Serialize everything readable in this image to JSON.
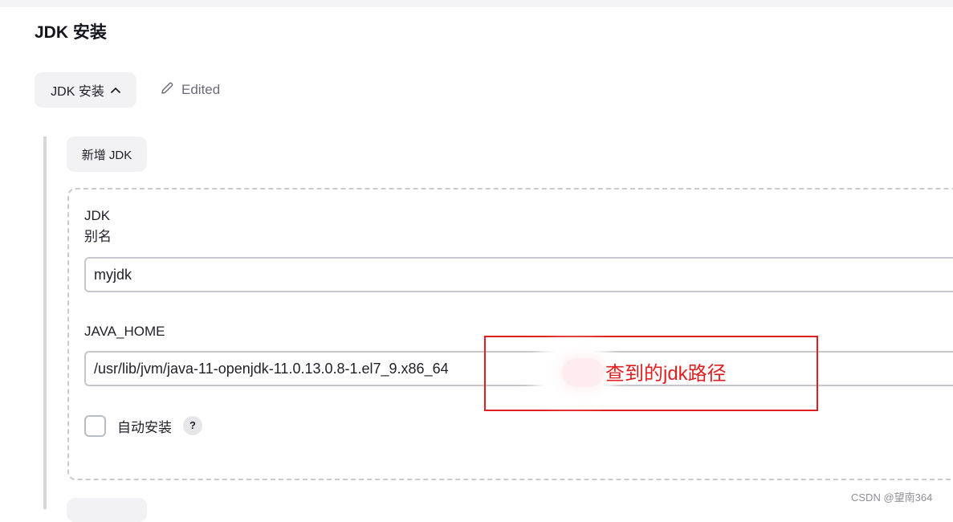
{
  "section": {
    "title": "JDK 安装"
  },
  "toolbar": {
    "toggle_label": "JDK 安装",
    "edited_label": "Edited"
  },
  "installations": {
    "add_button_label": "新增 JDK",
    "jdk": {
      "heading": "JDK",
      "alias_label": "别名",
      "alias_value": "myjdk",
      "java_home_label": "JAVA_HOME",
      "java_home_value": "/usr/lib/jvm/java-11-openjdk-11.0.13.0.8-1.el7_9.x86_64",
      "auto_install_label": "自动安装",
      "auto_install_checked": false,
      "help_label": "?"
    }
  },
  "annotation": {
    "text": "查到的jdk路径",
    "color": "#e02020"
  },
  "watermark": "CSDN @望南364",
  "colors": {
    "button_bg": "#f2f2f4",
    "border": "#c6c6cc",
    "annotation_red": "#e02020"
  }
}
